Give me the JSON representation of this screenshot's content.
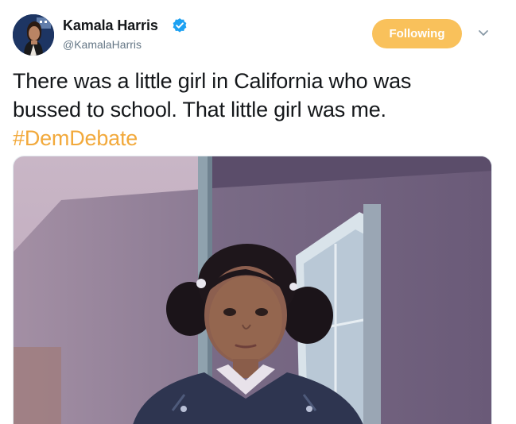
{
  "author": {
    "display_name": "Kamala Harris",
    "handle": "@KamalaHarris",
    "verified": true,
    "avatar_icon": "profile-photo"
  },
  "follow_button": {
    "label": "Following",
    "color": "#f9c15b"
  },
  "menu": {
    "icon": "chevron-down-icon"
  },
  "tweet": {
    "text_line1": "There was a little girl in California who was",
    "text_line2": "bussed to school. That little girl was me.",
    "hashtag": "#DemDebate",
    "hashtag_color": "#f2a93b"
  },
  "media": {
    "type": "photo"
  }
}
